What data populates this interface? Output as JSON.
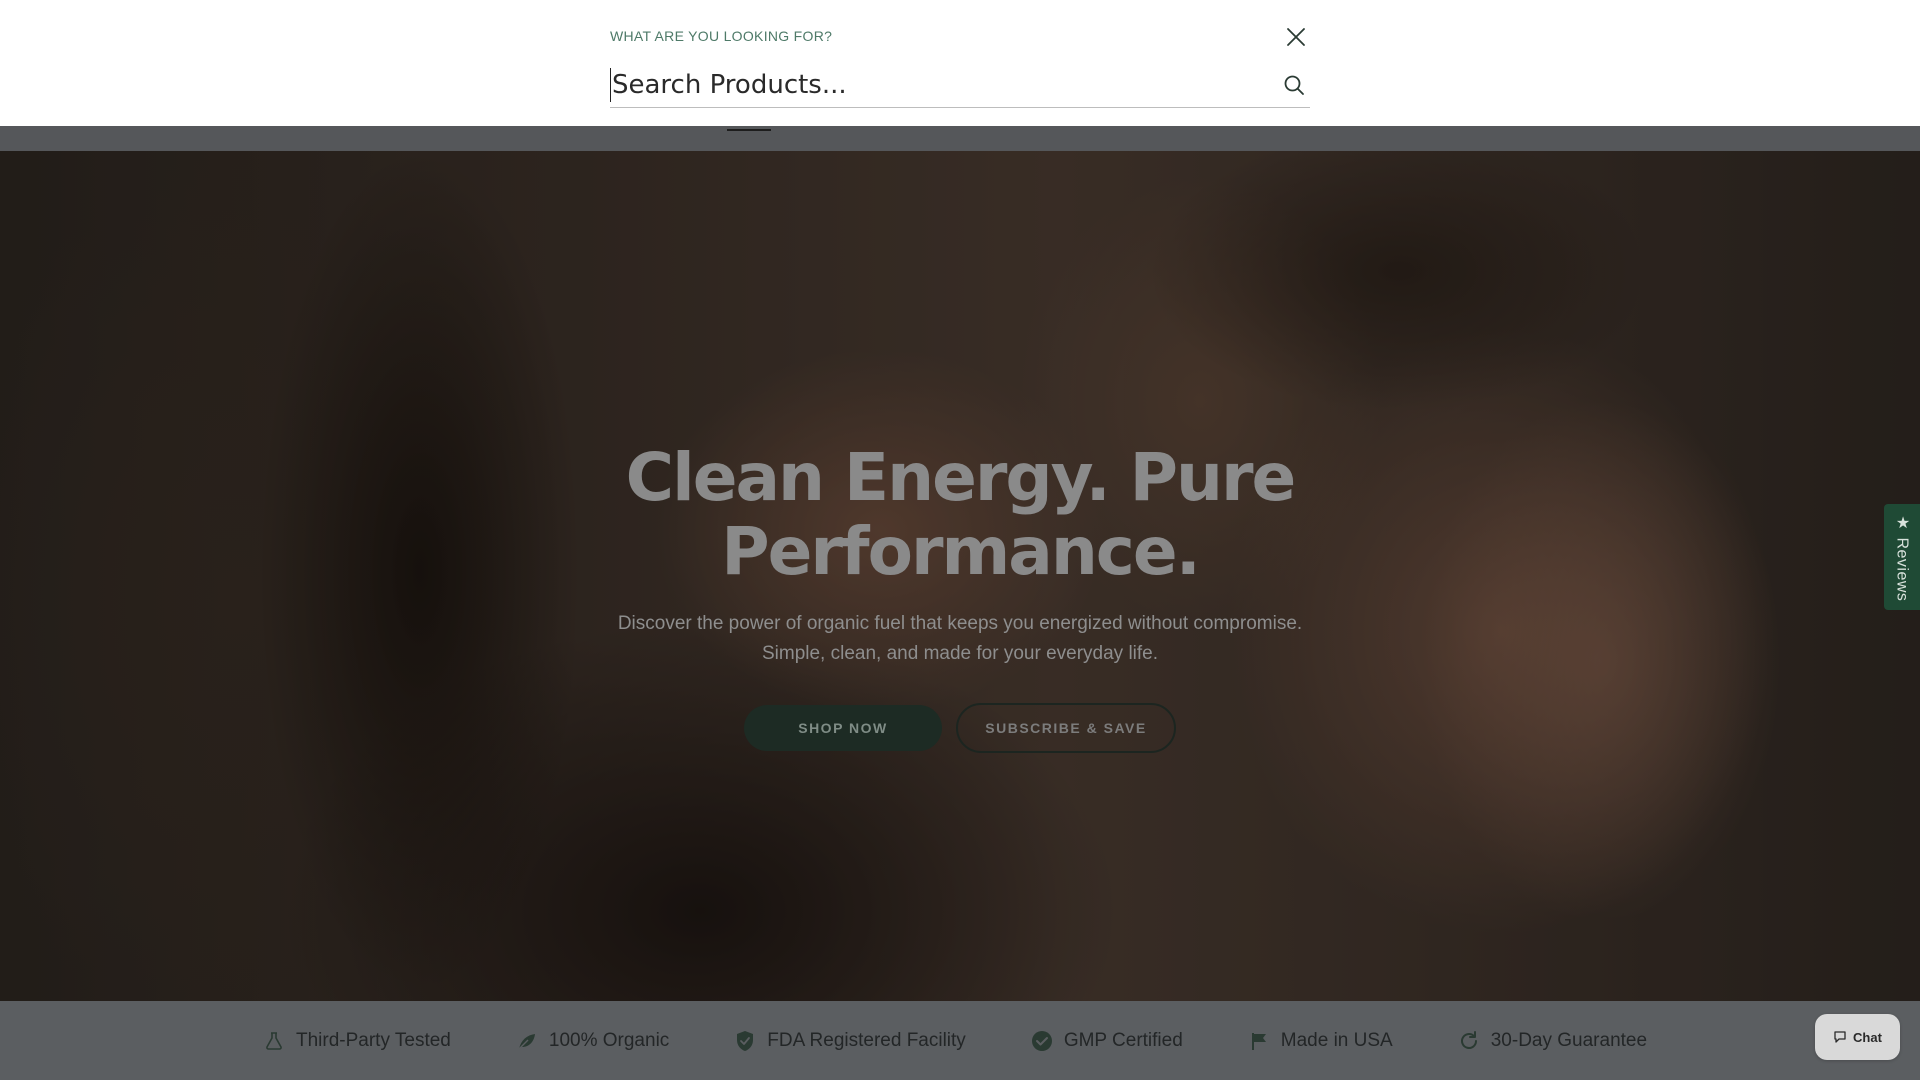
{
  "search": {
    "label": "WHAT ARE YOU LOOKING FOR?",
    "placeholder": "Search Products...",
    "value": ""
  },
  "hero": {
    "title": "Clean Energy. Pure Performance.",
    "subtitle": "Discover the power of organic fuel that keeps you energized without compromise. Simple, clean, and made for your everyday life.",
    "primary_button": "SHOP NOW",
    "secondary_button": "SUBSCRIBE & SAVE"
  },
  "reviews_tab": {
    "label": "★ Reviews"
  },
  "trust_bar": {
    "items": [
      {
        "label": "Third-Party Tested",
        "icon": "flask-icon"
      },
      {
        "label": "100% Organic",
        "icon": "leaf-icon"
      },
      {
        "label": "FDA Registered Facility",
        "icon": "shield-check-icon"
      },
      {
        "label": "GMP Certified",
        "icon": "check-circle-icon"
      },
      {
        "label": "Made in USA",
        "icon": "flag-icon"
      },
      {
        "label": "30-Day Guarantee",
        "icon": "refresh-icon"
      }
    ]
  },
  "chat": {
    "label": "Chat"
  },
  "colors": {
    "accent_green": "#1f4a35",
    "label_green": "#4e7a68",
    "overlay_panel": "#ffffff"
  }
}
